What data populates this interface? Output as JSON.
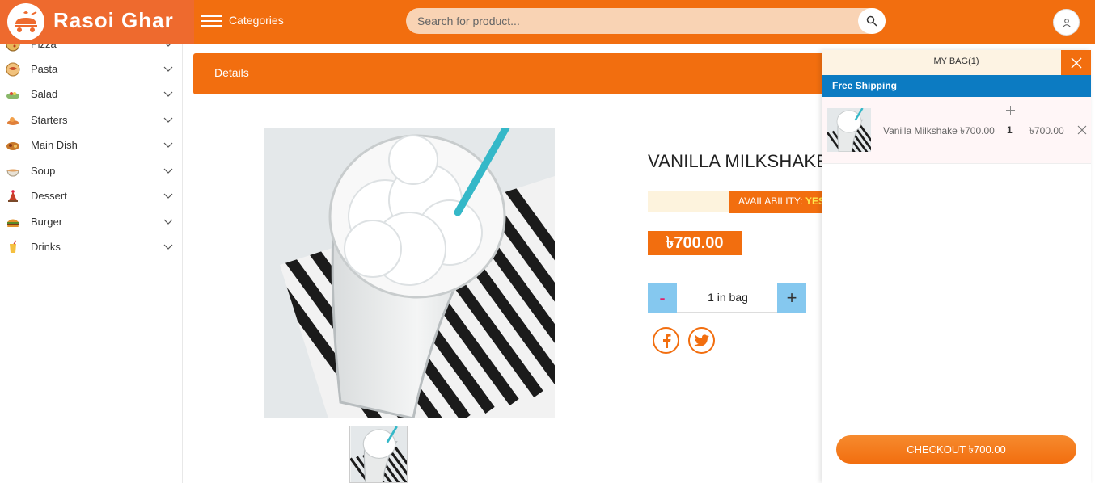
{
  "brand": {
    "name": "Rasoi Ghar"
  },
  "header": {
    "categories_label": "Categories",
    "search_placeholder": "Search for product..."
  },
  "sidebar": {
    "items": [
      {
        "label": "Pizza",
        "icon": "pizza-icon"
      },
      {
        "label": "Pasta",
        "icon": "pasta-icon"
      },
      {
        "label": "Salad",
        "icon": "salad-icon"
      },
      {
        "label": "Starters",
        "icon": "starters-icon"
      },
      {
        "label": "Main Dish",
        "icon": "main-dish-icon"
      },
      {
        "label": "Soup",
        "icon": "soup-icon"
      },
      {
        "label": "Dessert",
        "icon": "dessert-icon"
      },
      {
        "label": "Burger",
        "icon": "burger-icon"
      },
      {
        "label": "Drinks",
        "icon": "drinks-icon"
      }
    ]
  },
  "details": {
    "banner_label": "Details",
    "product_name": "VANILLA MILKSHAKE",
    "availability_label": "AVAILABILITY:",
    "availability_value": "YES",
    "price": "৳700.00",
    "qty_minus": "-",
    "qty_plus": "+",
    "qty_text": "1 in bag"
  },
  "cart": {
    "title": "MY BAG(1)",
    "free_shipping": "Free Shipping",
    "items": [
      {
        "name": "Vanilla Milkshake ৳700.00",
        "qty": "1",
        "total": "৳700.00"
      }
    ],
    "checkout_label": "CHECKOUT  ৳700.00"
  },
  "colors": {
    "primary": "#f26e0f",
    "shipping_blue": "#0c7bc2",
    "qty_button_blue": "#85c8ef"
  }
}
